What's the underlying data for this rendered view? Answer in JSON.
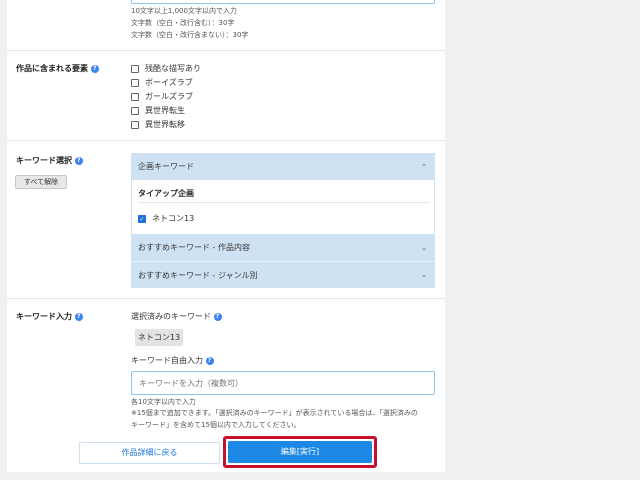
{
  "notes": {
    "range": "10文字以上1,000文字以内で入力",
    "count_with_space": "文字数（空白・改行含む）：30字",
    "count_without_space": "文字数（空白・改行含まない）：30字"
  },
  "elements": {
    "label": "作品に含まれる要素",
    "options": [
      {
        "label": "残酷な描写あり",
        "checked": false
      },
      {
        "label": "ボーイズラブ",
        "checked": false
      },
      {
        "label": "ガールズラブ",
        "checked": false
      },
      {
        "label": "異世界転生",
        "checked": false
      },
      {
        "label": "異世界転移",
        "checked": false
      }
    ]
  },
  "keyword_select": {
    "label": "キーワード選択",
    "clear_all": "すべて解除",
    "sections": {
      "project": "企画キーワード",
      "content": "おすすめキーワード - 作品内容",
      "genre": "おすすめキーワード - ジャンル別"
    },
    "subheading": "タイアップ企画",
    "item": {
      "label": "ネトコン13",
      "checked": true
    }
  },
  "keyword_input": {
    "label": "キーワード入力",
    "selected_label": "選択済みのキーワード",
    "selected_tag": "ネトコン13",
    "free_label": "キーワード自由入力",
    "placeholder": "キーワードを入力（複数可）",
    "note1": "各10文字以内で入力",
    "note2": "※15個まで追加できます。「選択済みのキーワード」が表示されている場合は、「選択済みの",
    "note3": "キーワード」を含めて15個以内で入力してください。"
  },
  "buttons": {
    "back": "作品詳細に戻る",
    "submit": "編集[実行]"
  },
  "colors": {
    "accent": "#1e88e5",
    "accordion": "#cfe2f4",
    "highlight_border": "#c8102e",
    "help_icon": "#3b82f6"
  }
}
